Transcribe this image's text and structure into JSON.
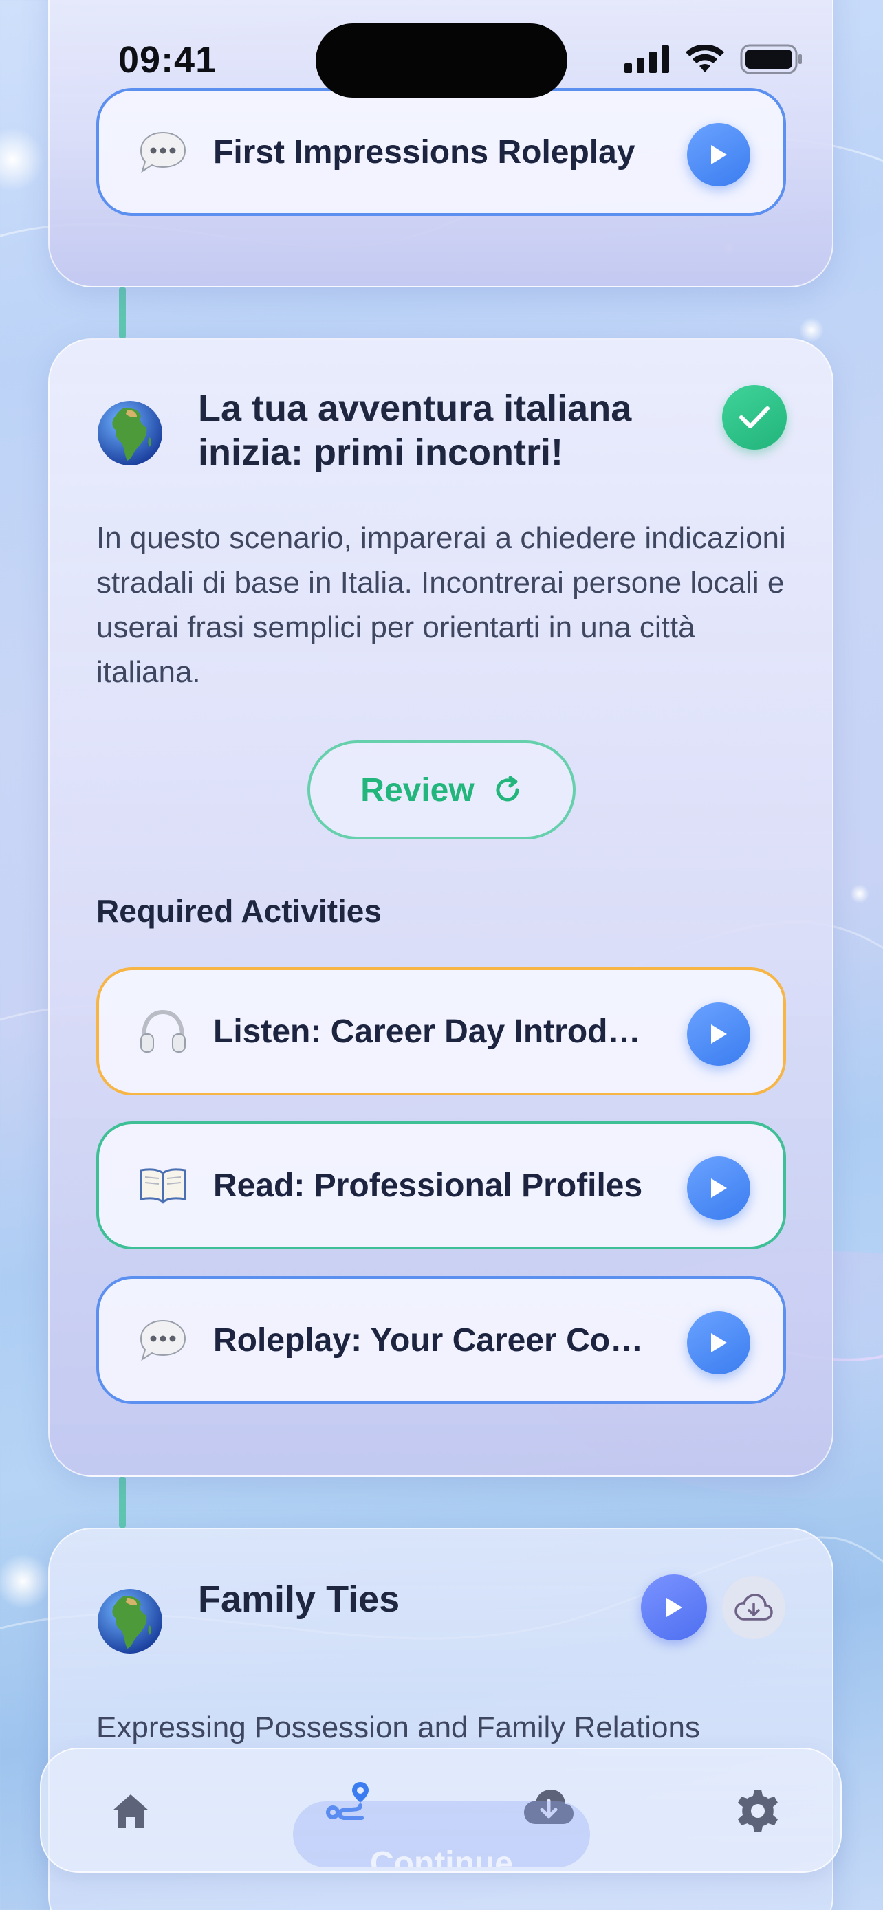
{
  "status_bar": {
    "time": "09:41"
  },
  "top_card": {
    "activity": {
      "label": "First Impressions Roleplay",
      "icon": "speech-bubble-icon"
    }
  },
  "lesson": {
    "title": "La tua avventura italiana inizia: primi incontri!",
    "title_line1": "La tua avventura italiana",
    "title_line2": "inizia: primi incontri!",
    "icon": "globe-icon",
    "completed": true,
    "description": "In questo scenario, imparerai a chiedere indicazioni stradali di base in Italia. Incontrerai persone locali e userai frasi semplici per orientarti in una città italiana.",
    "review_label": "Review",
    "required_heading": "Required Activities",
    "activities": [
      {
        "label": "Listen: Career Day Introduc...",
        "icon": "headphones-icon",
        "color": "#f6b545"
      },
      {
        "label": "Read: Professional Profiles",
        "icon": "open-book-icon",
        "color": "#3fbf95"
      },
      {
        "label": "Roleplay: Your Career Coun...",
        "icon": "speech-bubble-icon",
        "color": "#5b8ff0"
      }
    ]
  },
  "next_lesson": {
    "title": "Family Ties",
    "subtitle": "Expressing Possession and Family Relations",
    "icon": "globe-icon"
  },
  "tabbar": {
    "items": [
      {
        "name": "home",
        "icon": "home-icon"
      },
      {
        "name": "path",
        "icon": "route-icon",
        "active": true
      },
      {
        "name": "downloads",
        "icon": "cloud-download-icon"
      },
      {
        "name": "settings",
        "icon": "gear-icon"
      }
    ],
    "continue_label": "Continue"
  },
  "colors": {
    "accent_blue": "#3b7df0",
    "success_green": "#22b57c",
    "connector": "#5fc6b0",
    "nav_icon": "#5d6479"
  }
}
